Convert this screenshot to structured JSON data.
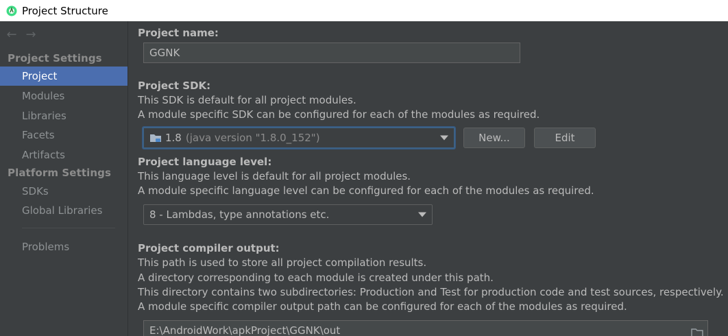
{
  "window": {
    "title": "Project Structure"
  },
  "nav": {
    "back": "←",
    "forward": "→"
  },
  "sidebar": {
    "project_settings_header": "Project Settings",
    "platform_settings_header": "Platform Settings",
    "items": [
      {
        "label": "Project",
        "selected": true
      },
      {
        "label": "Modules"
      },
      {
        "label": "Libraries"
      },
      {
        "label": "Facets"
      },
      {
        "label": "Artifacts"
      },
      {
        "label": "SDKs"
      },
      {
        "label": "Global Libraries"
      },
      {
        "label": "Problems"
      }
    ]
  },
  "project_name": {
    "label": "Project name:",
    "value": "GGNK"
  },
  "project_sdk": {
    "label": "Project SDK:",
    "desc1": "This SDK is default for all project modules.",
    "desc2": "A module specific SDK can be configured for each of the modules as required.",
    "selected": "1.8",
    "selected_detail": "(java version \"1.8.0_152\")",
    "new_button": "New...",
    "edit_button": "Edit"
  },
  "language_level": {
    "label": "Project language level:",
    "desc1": "This language level is default for all project modules.",
    "desc2": "A module specific language level can be configured for each of the modules as required.",
    "selected": "8 - Lambdas, type annotations etc."
  },
  "compiler_output": {
    "label": "Project compiler output:",
    "desc1": "This path is used to store all project compilation results.",
    "desc2": "A directory corresponding to each module is created under this path.",
    "desc3": "This directory contains two subdirectories: Production and Test for production code and test sources, respectively.",
    "desc4": "A module specific compiler output path can be configured for each of the modules as required.",
    "path": "E:\\AndroidWork\\apkProject\\GGNK\\out"
  },
  "colors": {
    "selection": "#4b6eaf",
    "background": "#3c3f41",
    "text": "#bbbbbb"
  }
}
